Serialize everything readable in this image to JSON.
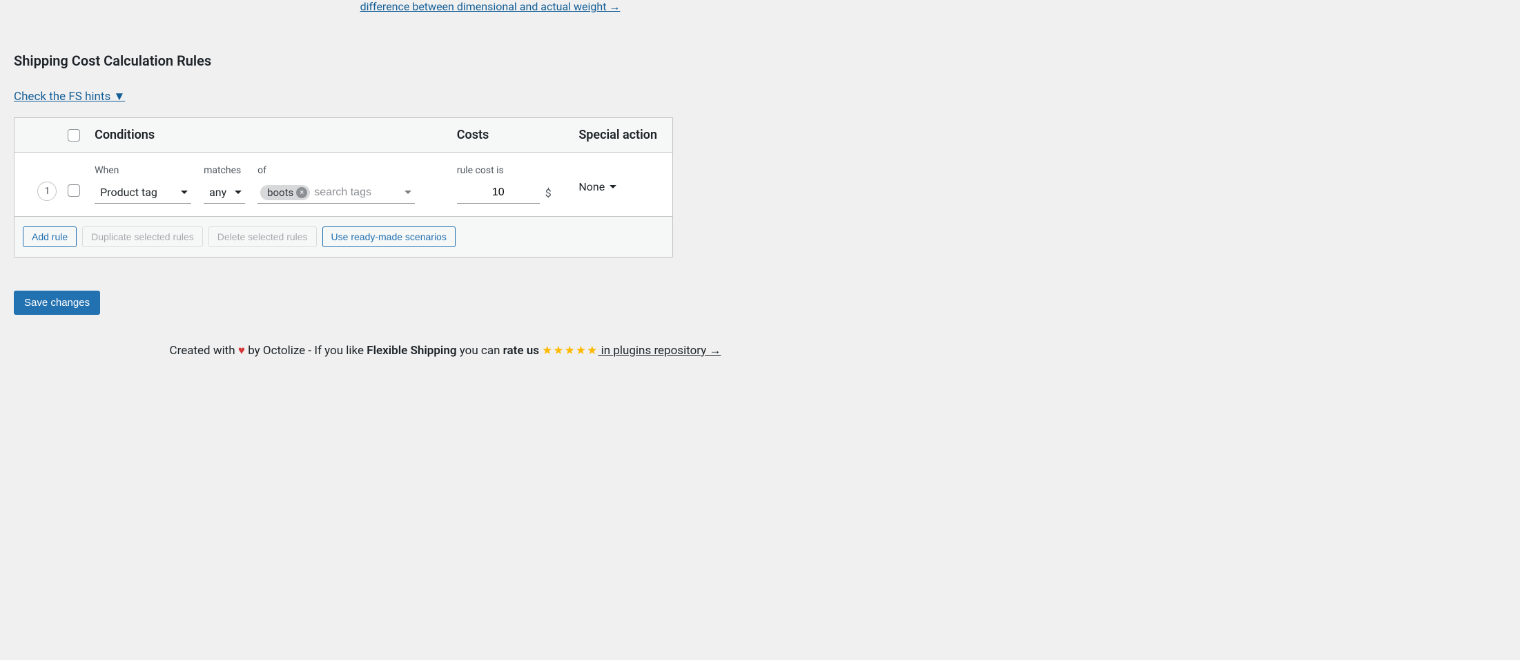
{
  "top_partial_link": "difference between dimensional and actual weight →",
  "section_title": "Shipping Cost Calculation Rules",
  "hints_link": "Check the FS hints ▼",
  "table": {
    "headers": {
      "conditions": "Conditions",
      "costs": "Costs",
      "special": "Special action"
    },
    "row": {
      "number": "1",
      "when_label": "When",
      "when_value": "Product tag",
      "matches_label": "matches",
      "matches_value": "any",
      "of_label": "of",
      "tag_chip": "boots",
      "tags_placeholder": "search tags",
      "cost_label": "rule cost is",
      "cost_value": "10",
      "currency": "$",
      "special_value": "None"
    },
    "footer": {
      "add": "Add rule",
      "duplicate": "Duplicate selected rules",
      "delete": "Delete selected rules",
      "scenarios": "Use ready-made scenarios"
    }
  },
  "save_button": "Save changes",
  "footer": {
    "p1": "Created with ",
    "heart": "♥",
    "p2": " by Octolize - If you like ",
    "strong": "Flexible Shipping",
    "p3": " you can ",
    "rate": "rate us ",
    "stars": "★★★★★",
    "link": " in plugins repository →"
  }
}
